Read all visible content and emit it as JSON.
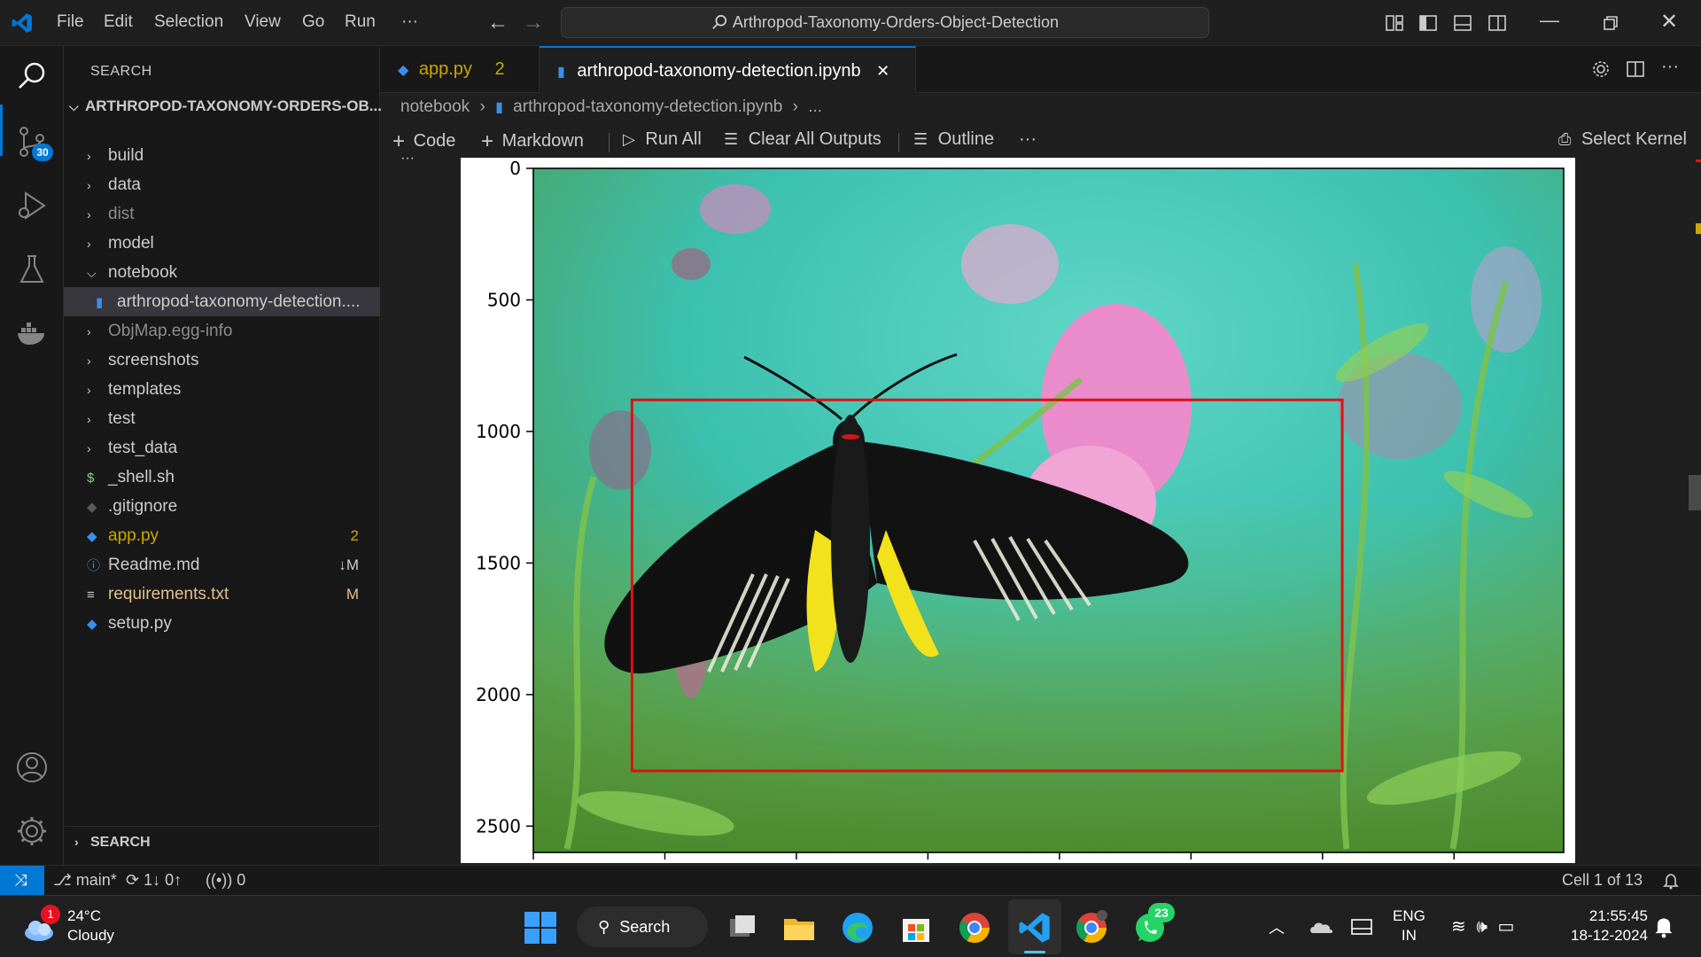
{
  "titlebar": {
    "menu": [
      "File",
      "Edit",
      "Selection",
      "View",
      "Go",
      "Run"
    ],
    "more": "···",
    "command_center": "Arthropod-Taxonomy-Orders-Object-Detection"
  },
  "activitybar": {
    "source_control_badge": "30"
  },
  "sidebar": {
    "title": "SEARCH",
    "root": "ARTHROPOD-TAXONOMY-ORDERS-OB...",
    "items": [
      {
        "label": "build",
        "type": "folder",
        "expanded": false
      },
      {
        "label": "data",
        "type": "folder",
        "expanded": false
      },
      {
        "label": "dist",
        "type": "folder",
        "expanded": false,
        "dim": true
      },
      {
        "label": "model",
        "type": "folder",
        "expanded": false
      },
      {
        "label": "notebook",
        "type": "folder",
        "expanded": true
      },
      {
        "label": "arthropod-taxonomy-detection....",
        "type": "notebook",
        "selected": true
      },
      {
        "label": "ObjMap.egg-info",
        "type": "folder",
        "expanded": false,
        "dim": true
      },
      {
        "label": "screenshots",
        "type": "folder",
        "expanded": false
      },
      {
        "label": "templates",
        "type": "folder",
        "expanded": false
      },
      {
        "label": "test",
        "type": "folder",
        "expanded": false
      },
      {
        "label": "test_data",
        "type": "folder",
        "expanded": false
      },
      {
        "label": "_shell.sh",
        "type": "shell",
        "icon": "$"
      },
      {
        "label": ".gitignore",
        "type": "git"
      },
      {
        "label": "app.py",
        "type": "python",
        "badge": "2",
        "color": "#cca700"
      },
      {
        "label": "Readme.md",
        "type": "info",
        "badge": "↓M"
      },
      {
        "label": "requirements.txt",
        "type": "text",
        "badge": "M",
        "color": "#e2c08d"
      },
      {
        "label": "setup.py",
        "type": "python"
      }
    ],
    "search_section": "SEARCH"
  },
  "tabs": [
    {
      "label": "app.py",
      "badge": "2",
      "active": false
    },
    {
      "label": "arthropod-taxonomy-detection.ipynb",
      "active": true,
      "close": "✕"
    }
  ],
  "breadcrumb": {
    "folder": "notebook",
    "file": "arthropod-taxonomy-detection.ipynb",
    "more": "..."
  },
  "nb_toolbar": {
    "code": "Code",
    "markdown": "Markdown",
    "run_all": "Run All",
    "clear_outputs": "Clear All Outputs",
    "outline": "Outline",
    "more": "···",
    "select_kernel": "Select Kernel"
  },
  "chart_data": {
    "type": "image",
    "y_ticks": [
      "0",
      "500",
      "1000",
      "1500",
      "2000",
      "2500"
    ],
    "y_range": [
      0,
      2600
    ],
    "bounding_box_color": "#e01010",
    "bounding_box_data": {
      "x_range": [
        375,
        3075
      ],
      "y_range": [
        880,
        2290
      ]
    }
  },
  "statusbar": {
    "branch": "main*",
    "sync": "1↓ 0↑",
    "ports": "0",
    "cell": "Cell 1 of 13"
  },
  "taskbar": {
    "weather_temp": "24°C",
    "weather_desc": "Cloudy",
    "weather_badge": "1",
    "search": "Search",
    "whatsapp_badge": "23",
    "lang_top": "ENG",
    "lang_bottom": "IN",
    "time": "21:55:45",
    "date": "18-12-2024"
  }
}
